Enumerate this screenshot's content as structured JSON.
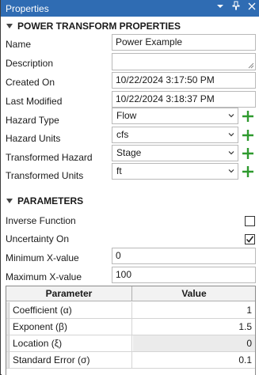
{
  "window": {
    "title": "Properties",
    "controls": [
      "▾",
      "ᵩ",
      "✕"
    ]
  },
  "power_transform": {
    "section_title": "POWER TRANSFORM PROPERTIES",
    "name_label": "Name",
    "name_value": "Power Example",
    "description_label": "Description",
    "description_value": "",
    "created_label": "Created On",
    "created_value": "10/22/2024 3:17:50 PM",
    "modified_label": "Last Modified",
    "modified_value": "10/22/2024 3:18:37 PM",
    "hazard_type_label": "Hazard Type",
    "hazard_type_value": "Flow",
    "hazard_units_label": "Hazard Units",
    "hazard_units_value": "cfs",
    "transformed_hazard_label": "Transformed Hazard",
    "transformed_hazard_value": "Stage",
    "transformed_units_label": "Transformed Units",
    "transformed_units_value": "ft"
  },
  "parameters": {
    "section_title": "PARAMETERS",
    "inverse_label": "Inverse Function",
    "inverse_checked": false,
    "uncertainty_label": "Uncertainty On",
    "uncertainty_checked": true,
    "min_x_label": "Minimum X-value",
    "min_x_value": "0",
    "max_x_label": "Maximum X-value",
    "max_x_value": "100",
    "table": {
      "headers": [
        "Parameter",
        "Value"
      ],
      "rows": [
        {
          "name": "Coefficient (α)",
          "value": "1",
          "readonly": false
        },
        {
          "name": "Exponent (β)",
          "value": "1.5",
          "readonly": false
        },
        {
          "name": "Location (ξ)",
          "value": "0",
          "readonly": true
        },
        {
          "name": "Standard Error (σ)",
          "value": "0.1",
          "readonly": false
        }
      ]
    }
  },
  "colors": {
    "titlebar": "#2f6cb3",
    "add_icon": "#2e9a2e",
    "readonly_cell": "#ebebeb"
  }
}
